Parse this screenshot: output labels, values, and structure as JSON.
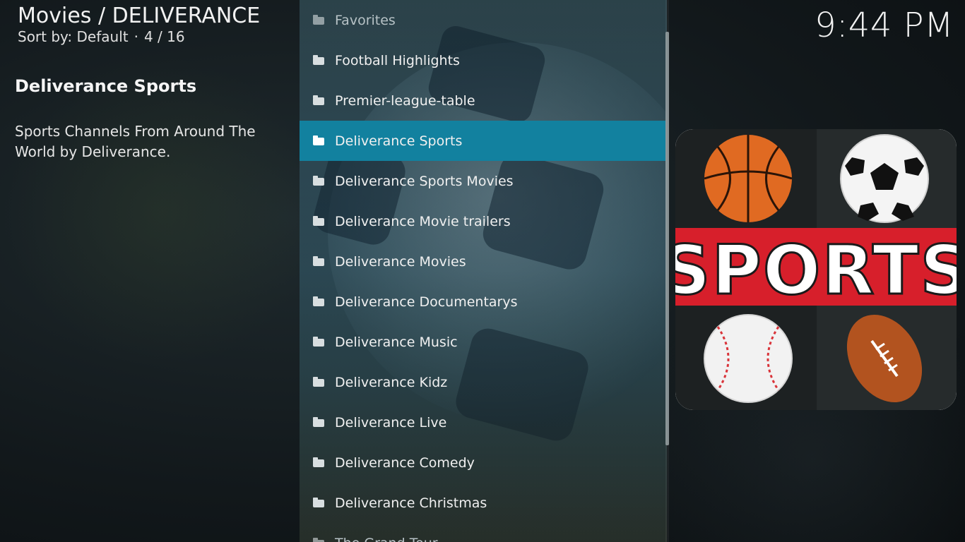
{
  "header": {
    "breadcrumb": "Movies / DELIVERANCE",
    "sort_label": "Sort by: Default",
    "separator": "·",
    "position": "4 / 16"
  },
  "clock": "9:44 PM",
  "info": {
    "title": "Deliverance Sports",
    "description": "Sports Channels From Around The World by Deliverance."
  },
  "list": {
    "items": [
      {
        "label": "Favorites"
      },
      {
        "label": "Football Highlights"
      },
      {
        "label": "Premier-league-table"
      },
      {
        "label": "Deliverance Sports"
      },
      {
        "label": "Deliverance Sports Movies"
      },
      {
        "label": "Deliverance Movie trailers"
      },
      {
        "label": "Deliverance Movies"
      },
      {
        "label": "Deliverance Documentarys"
      },
      {
        "label": "Deliverance Music"
      },
      {
        "label": "Deliverance Kidz"
      },
      {
        "label": "Deliverance Live"
      },
      {
        "label": "Deliverance Comedy"
      },
      {
        "label": "Deliverance Christmas"
      },
      {
        "label": "The Grand Tour"
      }
    ],
    "selected_index": 3,
    "icon": "folder-icon"
  },
  "thumbnail": {
    "text": "SPORTS",
    "colors": {
      "banner": "#d71f2b",
      "dark": "#1d2122",
      "basketball": "#e06a22",
      "football": "#b2531f"
    }
  },
  "theme": {
    "accent": "#12819f"
  }
}
